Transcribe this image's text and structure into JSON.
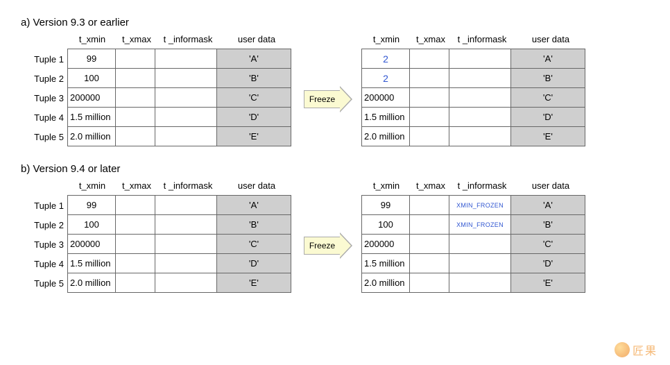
{
  "sections": {
    "a": {
      "title": "a) Version 9.3 or earlier"
    },
    "b": {
      "title": "b) Version 9.4 or later"
    }
  },
  "headers": {
    "xmin": "t_xmin",
    "xmax": "t_xmax",
    "info": "t _informask",
    "user": "user data"
  },
  "row_labels": [
    "Tuple 1",
    "Tuple 2",
    "Tuple 3",
    "Tuple 4",
    "Tuple 5"
  ],
  "freeze_label": "Freeze",
  "tables": {
    "a_left": [
      {
        "xmin": "99",
        "xmax": "",
        "info": "",
        "user": "'A'"
      },
      {
        "xmin": "100",
        "xmax": "",
        "info": "",
        "user": "'B'"
      },
      {
        "xmin": "200000",
        "xmax": "",
        "info": "",
        "user": "'C'"
      },
      {
        "xmin": "1.5 million",
        "xmax": "",
        "info": "",
        "user": "'D'"
      },
      {
        "xmin": "2.0 million",
        "xmax": "",
        "info": "",
        "user": "'E'"
      }
    ],
    "a_right": [
      {
        "xmin": "2",
        "xmin_frozen": true,
        "xmax": "",
        "info": "",
        "user": "'A'"
      },
      {
        "xmin": "2",
        "xmin_frozen": true,
        "xmax": "",
        "info": "",
        "user": "'B'"
      },
      {
        "xmin": "200000",
        "xmax": "",
        "info": "",
        "user": "'C'"
      },
      {
        "xmin": "1.5 million",
        "xmax": "",
        "info": "",
        "user": "'D'"
      },
      {
        "xmin": "2.0 million",
        "xmax": "",
        "info": "",
        "user": "'E'"
      }
    ],
    "b_left": [
      {
        "xmin": "99",
        "xmax": "",
        "info": "",
        "user": "'A'"
      },
      {
        "xmin": "100",
        "xmax": "",
        "info": "",
        "user": "'B'"
      },
      {
        "xmin": "200000",
        "xmax": "",
        "info": "",
        "user": "'C'"
      },
      {
        "xmin": "1.5 million",
        "xmax": "",
        "info": "",
        "user": "'D'"
      },
      {
        "xmin": "2.0 million",
        "xmax": "",
        "info": "",
        "user": "'E'"
      }
    ],
    "b_right": [
      {
        "xmin": "99",
        "xmax": "",
        "info": "XMIN_FROZEN",
        "info_blue": true,
        "user": "'A'"
      },
      {
        "xmin": "100",
        "xmax": "",
        "info": "XMIN_FROZEN",
        "info_blue": true,
        "user": "'B'"
      },
      {
        "xmin": "200000",
        "xmax": "",
        "info": "",
        "user": "'C'"
      },
      {
        "xmin": "1.5 million",
        "xmax": "",
        "info": "",
        "user": "'D'"
      },
      {
        "xmin": "2.0 million",
        "xmax": "",
        "info": "",
        "user": "'E'"
      }
    ]
  },
  "watermark": "匠果"
}
